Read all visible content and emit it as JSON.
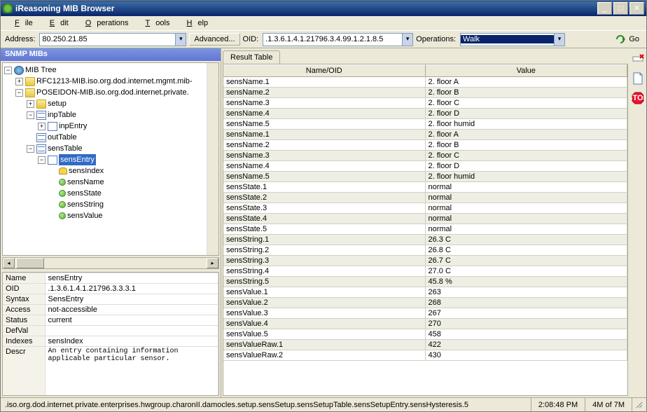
{
  "title": "iReasoning MIB Browser",
  "menu": [
    "File",
    "Edit",
    "Operations",
    "Tools",
    "Help"
  ],
  "toolbar": {
    "address_label": "Address:",
    "address_value": "80.250.21.85",
    "advanced_label": "Advanced...",
    "oid_label": "OID:",
    "oid_value": ".1.3.6.1.4.1.21796.3.4.99.1.2.1.8.5",
    "operations_label": "Operations:",
    "operations_value": "Walk",
    "go_label": "Go"
  },
  "left_title": "SNMP MIBs",
  "tree": {
    "root": "MIB Tree",
    "mib1": "RFC1213-MIB.iso.org.dod.internet.mgmt.mib-",
    "mib2": "POSEIDON-MIB.iso.org.dod.internet.private.",
    "setup": "setup",
    "inpTable": "inpTable",
    "inpEntry": "inpEntry",
    "outTable": "outTable",
    "sensTable": "sensTable",
    "sensEntry": "sensEntry",
    "sensIndex": "sensIndex",
    "sensName": "sensName",
    "sensState": "sensState",
    "sensString": "sensString",
    "sensValue": "sensValue"
  },
  "props": {
    "name_l": "Name",
    "name_v": "sensEntry",
    "oid_l": "OID",
    "oid_v": ".1.3.6.1.4.1.21796.3.3.3.1",
    "syntax_l": "Syntax",
    "syntax_v": "SensEntry",
    "access_l": "Access",
    "access_v": "not-accessible",
    "status_l": "Status",
    "status_v": "current",
    "defval_l": "DefVal",
    "defval_v": "",
    "indexes_l": "Indexes",
    "indexes_v": "sensIndex",
    "descr_l": "Descr",
    "descr_v": "An entry containing information applicable particular sensor."
  },
  "result_tab": "Result Table",
  "result_headers": {
    "name": "Name/OID",
    "value": "Value"
  },
  "rows": [
    {
      "n": "sensName.1",
      "v": "2. floor A"
    },
    {
      "n": "sensName.2",
      "v": "2. floor B"
    },
    {
      "n": "sensName.3",
      "v": "2. floor C"
    },
    {
      "n": "sensName.4",
      "v": "2. floor D"
    },
    {
      "n": "sensName.5",
      "v": "2. floor humid"
    },
    {
      "n": "sensName.1",
      "v": "2. floor A"
    },
    {
      "n": "sensName.2",
      "v": "2. floor B"
    },
    {
      "n": "sensName.3",
      "v": "2. floor C"
    },
    {
      "n": "sensName.4",
      "v": "2. floor D"
    },
    {
      "n": "sensName.5",
      "v": "2. floor humid"
    },
    {
      "n": "sensState.1",
      "v": "normal"
    },
    {
      "n": "sensState.2",
      "v": "normal"
    },
    {
      "n": "sensState.3",
      "v": "normal"
    },
    {
      "n": "sensState.4",
      "v": "normal"
    },
    {
      "n": "sensState.5",
      "v": "normal"
    },
    {
      "n": "sensString.1",
      "v": "26.3 C"
    },
    {
      "n": "sensString.2",
      "v": "26.8 C"
    },
    {
      "n": "sensString.3",
      "v": "26.7 C"
    },
    {
      "n": "sensString.4",
      "v": "27.0 C"
    },
    {
      "n": "sensString.5",
      "v": "45.8 %"
    },
    {
      "n": "sensValue.1",
      "v": "263"
    },
    {
      "n": "sensValue.2",
      "v": "268"
    },
    {
      "n": "sensValue.3",
      "v": "267"
    },
    {
      "n": "sensValue.4",
      "v": "270"
    },
    {
      "n": "sensValue.5",
      "v": "458"
    },
    {
      "n": "sensValueRaw.1",
      "v": "422"
    },
    {
      "n": "sensValueRaw.2",
      "v": "430"
    }
  ],
  "status": {
    "path": ".iso.org.dod.internet.private.enterprises.hwgroup.charonII.damocles.setup.sensSetup.sensSetupTable.sensSetupEntry.sensHysteresis.5",
    "time": "2:08:48 PM",
    "memory": "4M of 7M"
  }
}
